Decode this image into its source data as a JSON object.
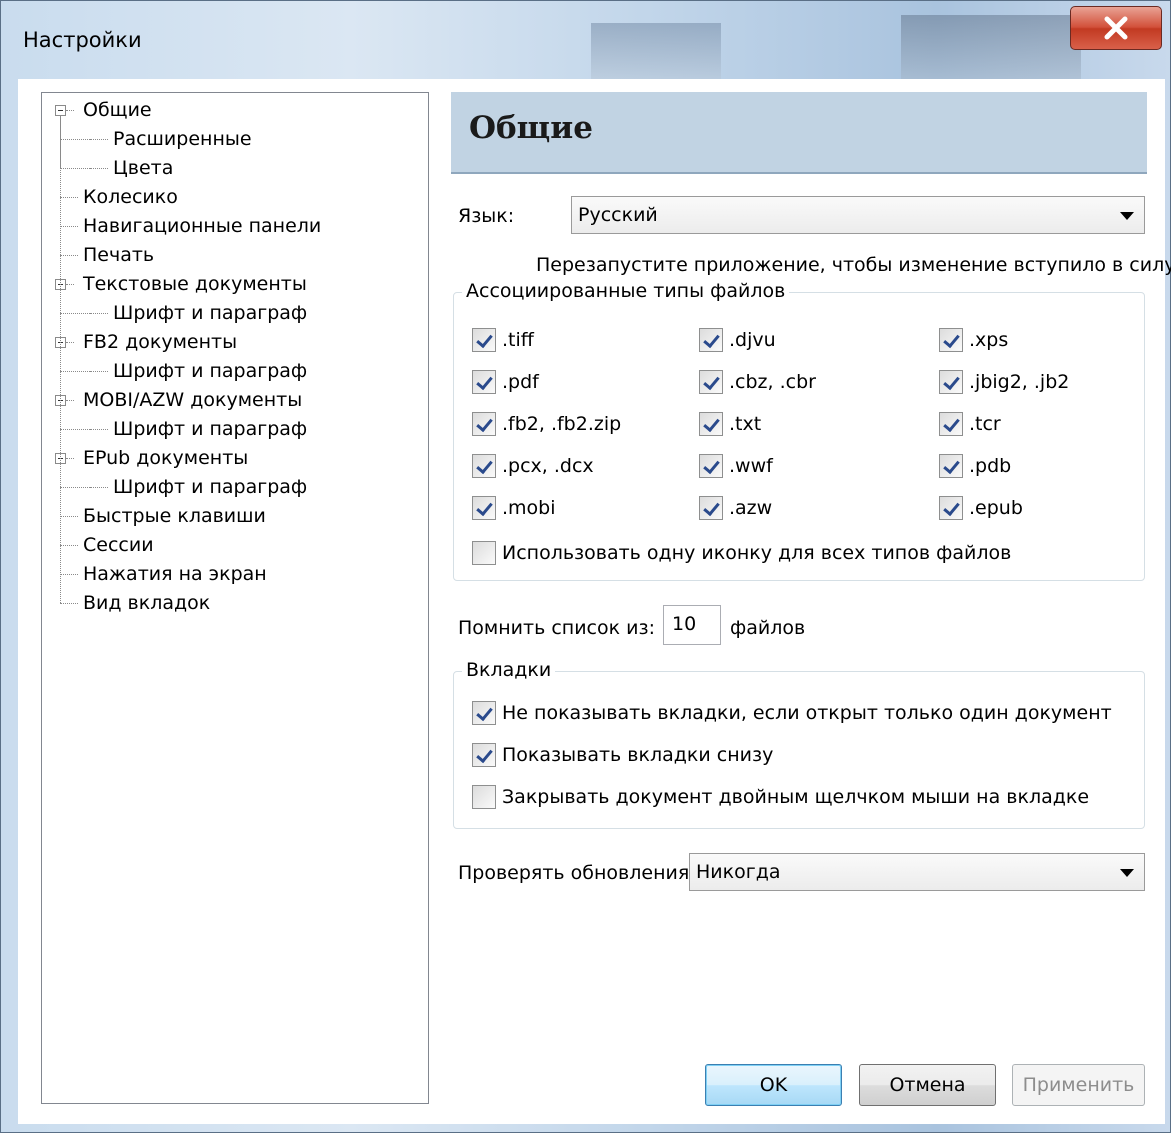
{
  "window": {
    "title": "Настройки"
  },
  "tree": [
    {
      "label": "Общие",
      "level": 0,
      "expanded": true,
      "selected": true
    },
    {
      "label": "Расширенные",
      "level": 1
    },
    {
      "label": "Цвета",
      "level": 1
    },
    {
      "label": "Колесико",
      "level": 0
    },
    {
      "label": "Навигационные панели",
      "level": 0
    },
    {
      "label": "Печать",
      "level": 0
    },
    {
      "label": "Текстовые документы",
      "level": 0,
      "expanded": true
    },
    {
      "label": "Шрифт и параграф",
      "level": 1
    },
    {
      "label": "FB2 документы",
      "level": 0,
      "expanded": true
    },
    {
      "label": "Шрифт и параграф",
      "level": 1
    },
    {
      "label": "MOBI/AZW документы",
      "level": 0,
      "expanded": true
    },
    {
      "label": "Шрифт и параграф",
      "level": 1
    },
    {
      "label": "EPub документы",
      "level": 0,
      "expanded": true
    },
    {
      "label": "Шрифт и параграф",
      "level": 1
    },
    {
      "label": "Быстрые клавиши",
      "level": 0
    },
    {
      "label": "Сессии",
      "level": 0
    },
    {
      "label": "Нажатия на экран",
      "level": 0
    },
    {
      "label": "Вид вкладок",
      "level": 0
    }
  ],
  "panel": {
    "title": "Общие",
    "language_label": "Язык:",
    "language_value": "Русский",
    "restart_note": "Перезапустите приложение, чтобы изменение вступило в силу.",
    "assoc_title": "Ассоциированные типы файлов",
    "filetypes": [
      [
        {
          "label": ".tiff",
          "checked": true
        },
        {
          "label": ".djvu",
          "checked": true
        },
        {
          "label": ".xps",
          "checked": true
        }
      ],
      [
        {
          "label": ".pdf",
          "checked": true
        },
        {
          "label": ".cbz, .cbr",
          "checked": true
        },
        {
          "label": ".jbig2, .jb2",
          "checked": true
        }
      ],
      [
        {
          "label": ".fb2, .fb2.zip",
          "checked": true
        },
        {
          "label": ".txt",
          "checked": true
        },
        {
          "label": ".tcr",
          "checked": true
        }
      ],
      [
        {
          "label": ".pcx, .dcx",
          "checked": true
        },
        {
          "label": ".wwf",
          "checked": true
        },
        {
          "label": ".pdb",
          "checked": true
        }
      ],
      [
        {
          "label": ".mobi",
          "checked": true
        },
        {
          "label": ".azw",
          "checked": true
        },
        {
          "label": ".epub",
          "checked": true
        }
      ]
    ],
    "single_icon": {
      "label": "Использовать одну иконку для всех типов файлов",
      "checked": false
    },
    "remember_label": "Помнить список из:",
    "remember_value": "10",
    "remember_suffix": "файлов",
    "tabs_title": "Вкладки",
    "tabs_options": [
      {
        "label": "Не показывать вкладки, если открыт только один документ",
        "checked": true
      },
      {
        "label": "Показывать вкладки снизу",
        "checked": true
      },
      {
        "label": "Закрывать документ двойным щелчком мыши на вкладке",
        "checked": false
      }
    ],
    "updates_label": "Проверять обновления:",
    "updates_value": "Никогда"
  },
  "buttons": {
    "ok": "OK",
    "cancel": "Отмена",
    "apply": "Применить"
  }
}
